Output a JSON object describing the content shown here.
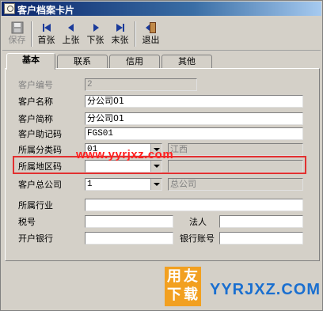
{
  "window": {
    "title": "客户档案卡片"
  },
  "toolbar": {
    "buttons": [
      {
        "label": "保存",
        "icon": "save-icon",
        "enabled": false
      },
      {
        "label": "首张",
        "icon": "first-icon",
        "enabled": true
      },
      {
        "label": "上张",
        "icon": "prev-icon",
        "enabled": true
      },
      {
        "label": "下张",
        "icon": "next-icon",
        "enabled": true
      },
      {
        "label": "末张",
        "icon": "last-icon",
        "enabled": true
      },
      {
        "label": "退出",
        "icon": "exit-icon",
        "enabled": true
      }
    ]
  },
  "tabs": [
    {
      "label": "基本",
      "active": true
    },
    {
      "label": "联系",
      "active": false
    },
    {
      "label": "信用",
      "active": false
    },
    {
      "label": "其他",
      "active": false
    }
  ],
  "form": {
    "customer_code": {
      "label": "客户编号",
      "value": "2",
      "readonly": true
    },
    "customer_name": {
      "label": "客户名称",
      "value": "分公司01"
    },
    "customer_abbr": {
      "label": "客户简称",
      "value": "分公司01"
    },
    "mnemonic_code": {
      "label": "客户助记码",
      "value": "FGS01"
    },
    "category_code": {
      "label": "所属分类码",
      "value": "01",
      "display": "江西"
    },
    "region_code": {
      "label": "所属地区码",
      "value": "",
      "display": ""
    },
    "head_company": {
      "label": "客户总公司",
      "value": "1",
      "display": "总公司"
    },
    "industry": {
      "label": "所属行业",
      "value": ""
    },
    "tax_no": {
      "label": "税号",
      "value": ""
    },
    "legal_person": {
      "label": "法人",
      "value": ""
    },
    "bank": {
      "label": "开户银行",
      "value": ""
    },
    "bank_account": {
      "label": "银行账号",
      "value": ""
    }
  },
  "overlay": {
    "watermark": "www.yyrjxz.com",
    "logo_chars": [
      "用",
      "友",
      "下",
      "载"
    ],
    "logo_text": "YYRJXZ.COM"
  },
  "colors": {
    "title_bar": "#0a246a",
    "highlight_box": "#e23030",
    "watermark": "#ff2020",
    "logo_orange": "#f2a020",
    "logo_blue": "#1a6fd0"
  }
}
